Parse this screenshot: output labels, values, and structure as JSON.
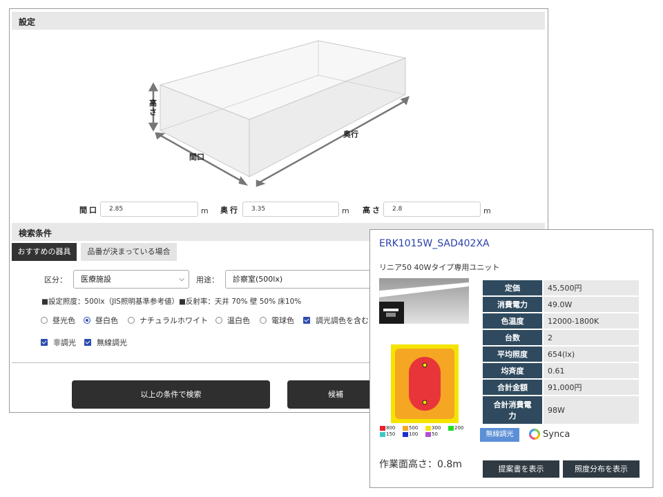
{
  "settings": {
    "header": "設定",
    "room_labels": {
      "height": "高さ",
      "depth": "奥行",
      "frontage": "間口"
    },
    "dims": [
      {
        "label": "間口",
        "value": "2.85",
        "unit": "m"
      },
      {
        "label": "奥行",
        "value": "3.35",
        "unit": "m"
      },
      {
        "label": "高さ",
        "value": "2.8",
        "unit": "m"
      }
    ]
  },
  "search": {
    "header": "検索条件",
    "tabs": [
      "おすすめの器具",
      "品番が決まっている場合"
    ],
    "category_label": "区分：",
    "category_value": "医療施設",
    "usage_label": "用途：",
    "usage_value": "診察室(500lx)",
    "info": "■設定照度：500lx（JIS照明基準参考値）■反射率：天井 70% 壁 50% 床10%",
    "colors": [
      {
        "label": "昼光色",
        "checked": false
      },
      {
        "label": "昼白色",
        "checked": true
      },
      {
        "label": "ナチュラルホワイト",
        "checked": false
      },
      {
        "label": "温白色",
        "checked": false
      },
      {
        "label": "電球色",
        "checked": false
      }
    ],
    "dimming_include": "調光調色を含む",
    "checks": [
      "非調光",
      "無線調光"
    ],
    "search_button": "以上の条件で検索",
    "second_button": "候補"
  },
  "product": {
    "name": "ERK1015W_SAD402XA",
    "description": "リニア50 40Wタイプ専用ユニット",
    "specs": [
      {
        "label": "定価",
        "value": "45,500円"
      },
      {
        "label": "消費電力",
        "value": "49.0W"
      },
      {
        "label": "色温度",
        "value": "12000-1800K"
      },
      {
        "label": "台数",
        "value": "2"
      },
      {
        "label": "平均照度",
        "value": "654(lx)"
      },
      {
        "label": "均斉度",
        "value": "0.61"
      },
      {
        "label": "合計金額",
        "value": "91,000円"
      },
      {
        "label": "合計消費電力",
        "value": "98W"
      }
    ],
    "legend_row1": [
      {
        "label": "800",
        "color": "#e8202a"
      },
      {
        "label": "500",
        "color": "#f5a623"
      },
      {
        "label": "300",
        "color": "#f5e400"
      },
      {
        "label": "200",
        "color": "#22dd22"
      }
    ],
    "legend_row2": [
      {
        "label": "150",
        "color": "#3ec8c8"
      },
      {
        "label": "100",
        "color": "#1a2fd0"
      },
      {
        "label": "50",
        "color": "#b050d0"
      }
    ],
    "badge": "無線調光",
    "brand": "Synca",
    "work_height": "作業面高さ：0.8m",
    "buttons": [
      "提案書を表示",
      "照度分布を表示"
    ]
  }
}
